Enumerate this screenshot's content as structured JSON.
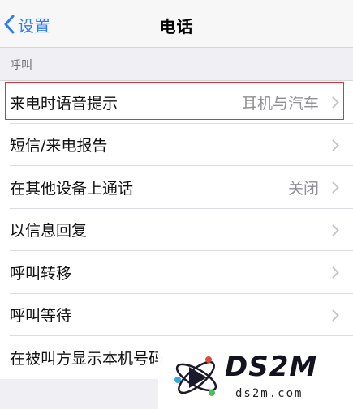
{
  "nav": {
    "back_label": "设置",
    "title": "电话"
  },
  "section_header": "呼叫",
  "rows": [
    {
      "label": "来电时语音提示",
      "value": "耳机与汽车"
    },
    {
      "label": "短信/来电报告",
      "value": ""
    },
    {
      "label": "在其他设备上通话",
      "value": "关闭"
    },
    {
      "label": "以信息回复",
      "value": ""
    },
    {
      "label": "呼叫转移",
      "value": ""
    },
    {
      "label": "呼叫等待",
      "value": ""
    },
    {
      "label": "在被叫方显示本机号码",
      "value": ""
    }
  ],
  "watermark": {
    "brand": "DS2M",
    "domain": "ds2m.com"
  },
  "colors": {
    "accent": "#2f7cf6",
    "highlight": "#e0323a",
    "background": "#efeff4"
  }
}
